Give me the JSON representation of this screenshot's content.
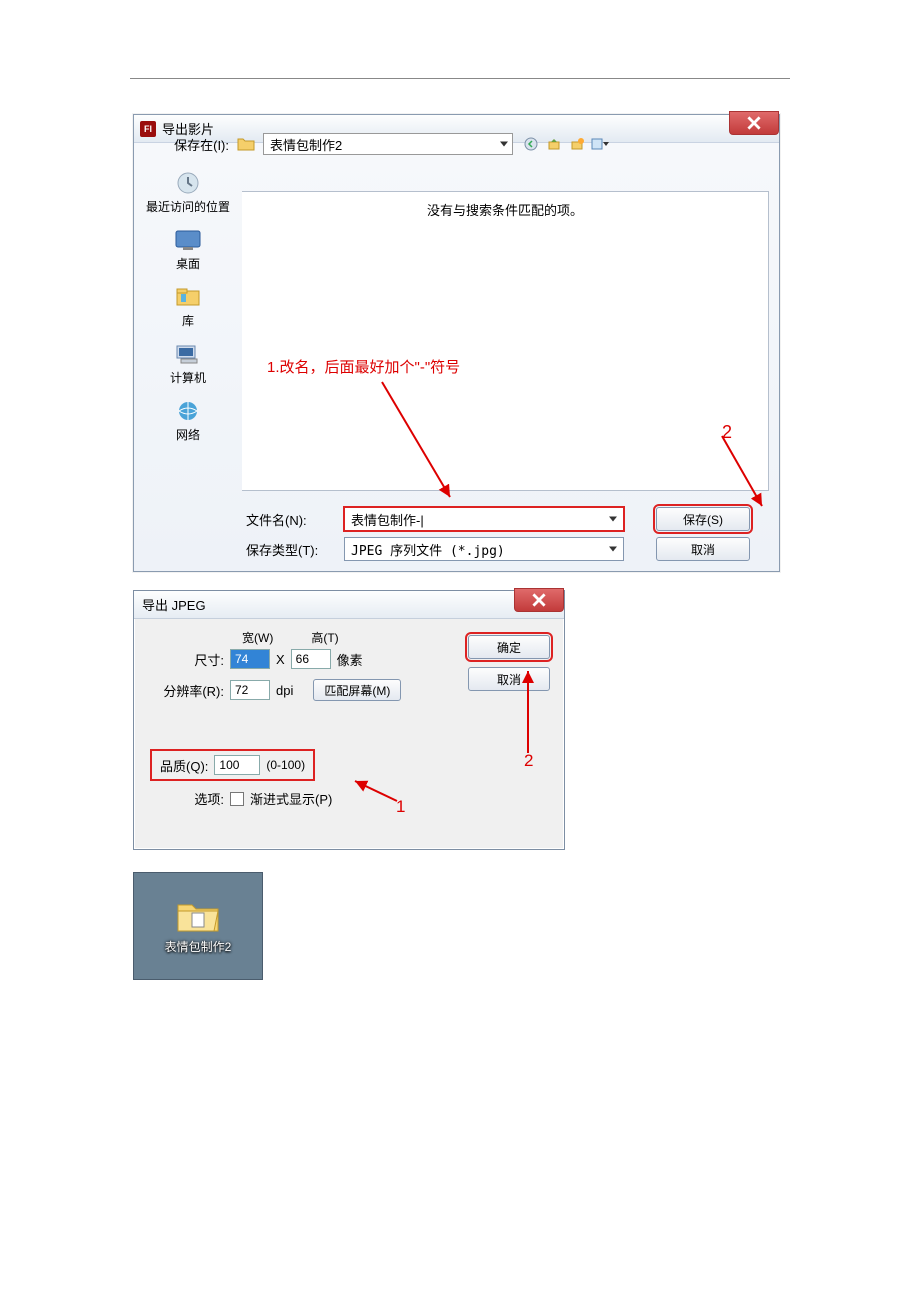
{
  "dialog1": {
    "title": "导出影片",
    "save_in_label": "保存在(I):",
    "save_in_value": "表情包制作2",
    "no_match": "没有与搜索条件匹配的项。",
    "places": [
      "最近访问的位置",
      "桌面",
      "库",
      "计算机",
      "网络"
    ],
    "annotation1": "1.改名，后面最好加个\"-\"符号",
    "annotation_num2": "2",
    "filename_label": "文件名(N):",
    "filename_value": "表情包制作-|",
    "filetype_label": "保存类型(T):",
    "filetype_value": "JPEG 序列文件 (*.jpg)",
    "save_btn": "保存(S)",
    "cancel_btn": "取消"
  },
  "dialog2": {
    "title": "导出 JPEG",
    "width_label": "宽(W)",
    "height_label": "高(T)",
    "size_label": "尺寸:",
    "width_value": "74",
    "height_value": "66",
    "px_label": "像素",
    "res_label": "分辨率(R):",
    "res_value": "72",
    "dpi": "dpi",
    "match_screen": "匹配屏幕(M)",
    "quality_label": "品质(Q):",
    "quality_value": "100",
    "quality_range": "(0-100)",
    "options_label": "选项:",
    "progressive": "渐进式显示(P)",
    "ok_btn": "确定",
    "cancel_btn": "取消",
    "annot1": "1",
    "annot2": "2"
  },
  "desktop_folder": "表情包制作2"
}
